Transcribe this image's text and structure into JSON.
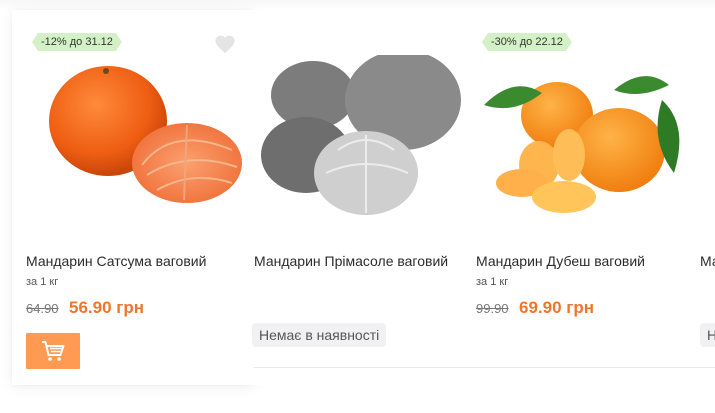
{
  "products": [
    {
      "discount_badge": "-12% до 31.12",
      "name": "Мандарин Сатсума ваговий",
      "unit": "за 1 кг",
      "old_price": "64.90",
      "price": "56.90 грн",
      "cart_icon": "cart-icon",
      "favorite_icon": "heart-icon"
    },
    {
      "name": "Мандарин Прімасоле ваговий",
      "stock_status": "Немає в наявності"
    },
    {
      "discount_badge": "-30% до 22.12",
      "name": "Мандарин Дубеш ваговий",
      "unit": "за 1 кг",
      "old_price": "99.90",
      "price": "69.90 грн"
    },
    {
      "name": "Ма",
      "stock_status": "Н"
    }
  ],
  "colors": {
    "accent": "#f0762b",
    "cart_button": "#ff9a52",
    "badge_bg": "#d4f0c6",
    "stock_badge_bg": "#f1f1f3"
  }
}
